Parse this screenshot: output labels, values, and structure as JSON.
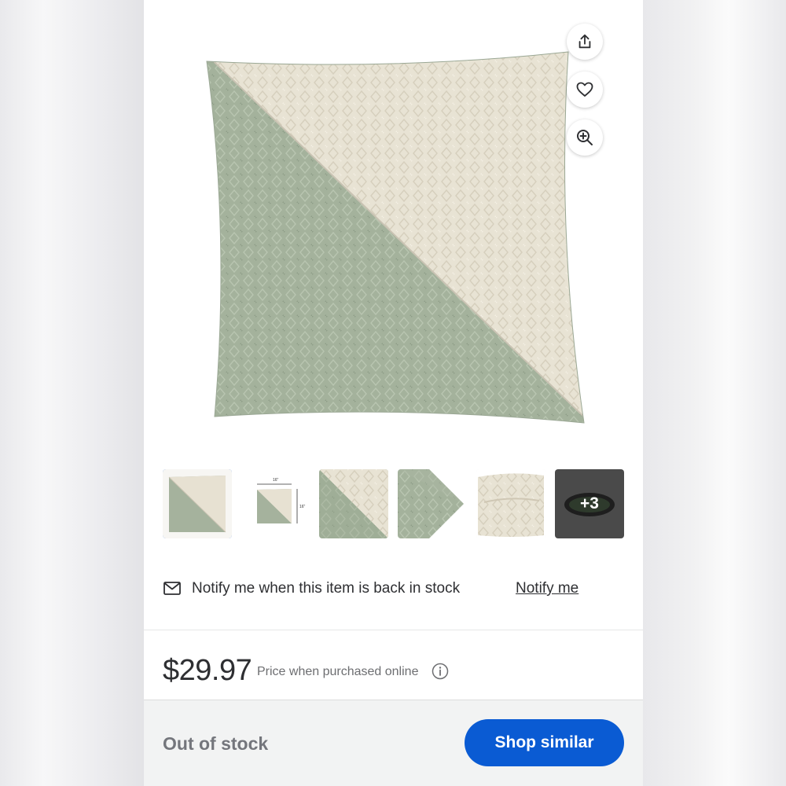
{
  "product": {
    "image_alt": "Square throw pillow with diagonal split of sage green and cream textured fabric",
    "thumbnails": [
      {
        "name": "front"
      },
      {
        "name": "dimensions",
        "dimension_label": "16\""
      },
      {
        "name": "fabric-close-up"
      },
      {
        "name": "corner-close-up"
      },
      {
        "name": "zipper-close-up"
      }
    ],
    "more_count": "+3"
  },
  "actions": {
    "share_icon": "share-icon",
    "favorite_icon": "heart-icon",
    "zoom_icon": "zoom-in-icon"
  },
  "notify": {
    "icon": "mail-icon",
    "text": "Notify me when this item is back in stock",
    "link": "Notify me"
  },
  "pricing": {
    "price": "$29.97",
    "note": "Price when purchased online",
    "info_icon": "info-icon"
  },
  "footer": {
    "status": "Out of stock",
    "button": "Shop similar"
  },
  "colors": {
    "sage": "#a3b19b",
    "cream": "#e8e2d3",
    "primary_blue": "#0a5bd3",
    "selected_border": "#2f6fd8"
  }
}
